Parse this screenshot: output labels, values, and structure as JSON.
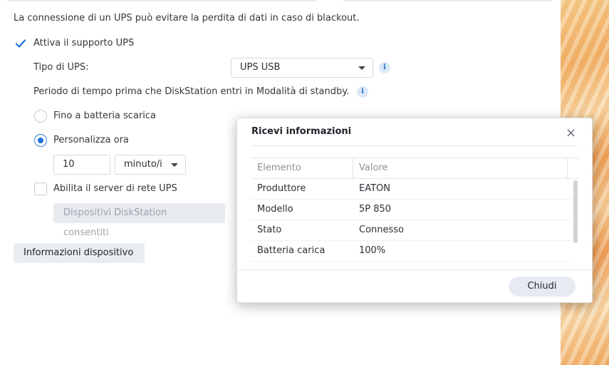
{
  "intro_text": "La connessione di un UPS può evitare la perdita di dati in caso di blackout.",
  "ups_support": {
    "label": "Attiva il supporto UPS",
    "checked": true
  },
  "ups_type": {
    "label": "Tipo di UPS:",
    "value": "UPS USB"
  },
  "standby_period": {
    "label": "Periodo di tempo prima che DiskStation entri in Modalità di standby."
  },
  "radio_options": [
    {
      "label": "Fino a batteria scarica",
      "checked": false
    },
    {
      "label": "Personalizza ora",
      "checked": true
    }
  ],
  "custom_time": {
    "value": "10",
    "unit": "minuto/i"
  },
  "network_server": {
    "label": "Abilita il server di rete UPS",
    "checked": false
  },
  "allowed_devices_button": "Dispositivi DiskStation consentiti",
  "device_info_button": "Informazioni dispositivo",
  "info_icon_glyph": "i",
  "dialog": {
    "title": "Ricevi informazioni",
    "close_glyph": "×",
    "columns": [
      "Elemento",
      "Valore"
    ],
    "rows": [
      {
        "item": "Produttore",
        "value": "EATON"
      },
      {
        "item": "Modello",
        "value": "5P 850"
      },
      {
        "item": "Stato",
        "value": "Connesso"
      },
      {
        "item": "Batteria carica",
        "value": "100%"
      }
    ],
    "close_button": "Chiudi"
  },
  "colors": {
    "accent": "#1e6fd9",
    "info_bg": "#dbe9f9"
  }
}
